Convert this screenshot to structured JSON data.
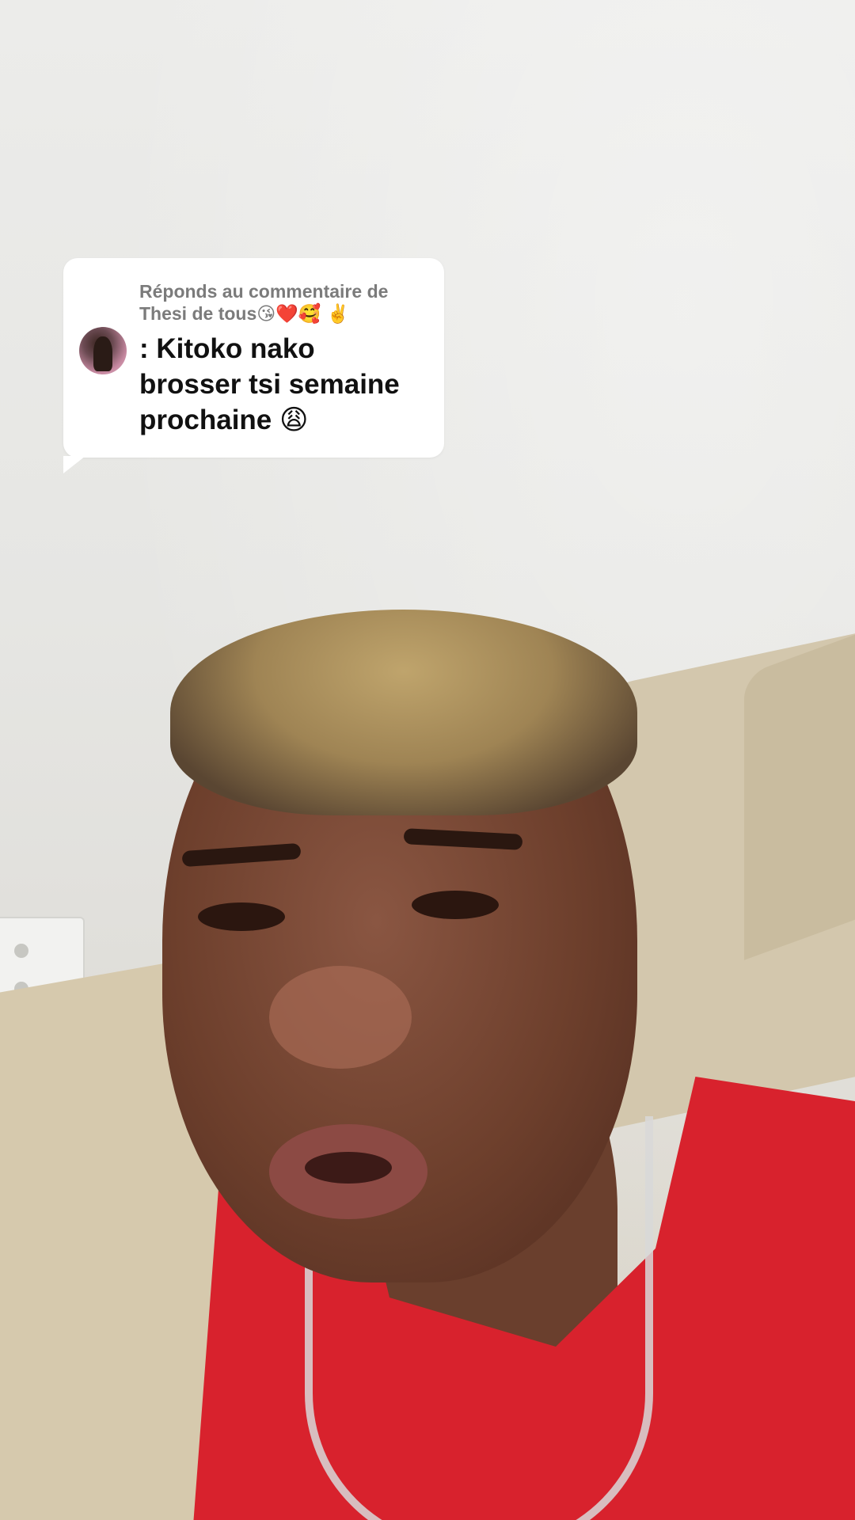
{
  "reply_card": {
    "header_line1": "Réponds au commentaire de",
    "header_name": "Thesi de tous",
    "header_emojis": "😘❤️🥰 ✌️",
    "comment_line1": ": Kitoko nako",
    "comment_line2": "brosser tsi semaine",
    "comment_line3": "prochaine",
    "comment_emoji": "😩"
  },
  "icons": {
    "avatar": "user-avatar"
  }
}
